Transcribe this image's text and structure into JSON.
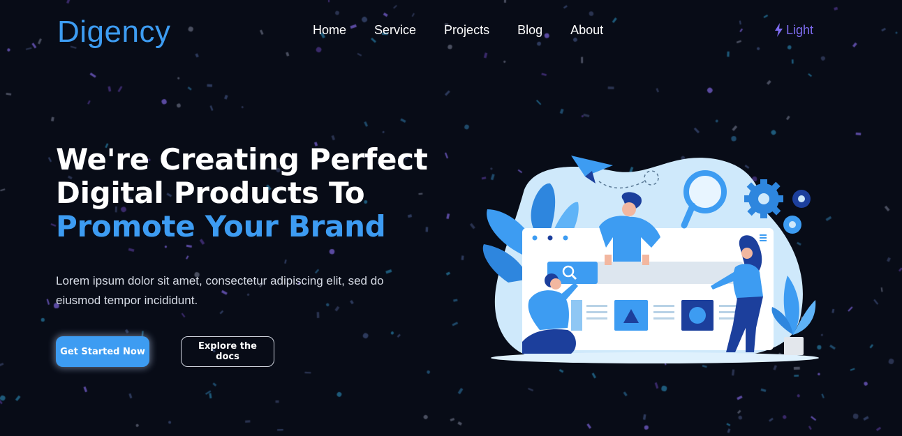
{
  "brand": {
    "logo_text": "Digency",
    "primary_color": "#3d9cf2",
    "accent_purple": "#7e6cf0",
    "background": "#080c17"
  },
  "nav": {
    "items": [
      {
        "label": "Home"
      },
      {
        "label": "Service"
      },
      {
        "label": "Projects"
      },
      {
        "label": "Blog"
      },
      {
        "label": "About"
      }
    ],
    "theme_toggle": {
      "label": "Light",
      "icon": "lightning-bolt-icon"
    }
  },
  "hero": {
    "title_line1": "We're Creating Perfect",
    "title_line2": "Digital Products To",
    "title_line3": "Promote Your Brand",
    "description": "Lorem ipsum dolor sit amet, consectetur adipiscing elit, sed do eiusmod tempor incididunt.",
    "primary_button": "Get Started Now",
    "secondary_button": "Explore the docs"
  },
  "illustration": {
    "name": "team-building-website-illustration",
    "icons": [
      "paper-plane-icon",
      "magnifier-icon",
      "gear-icon",
      "plant-icon"
    ]
  }
}
